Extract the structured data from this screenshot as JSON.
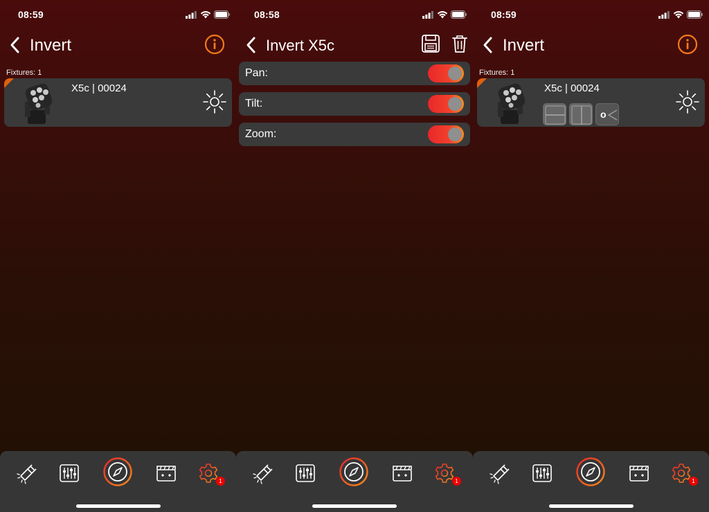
{
  "colors": {
    "accent": "#f27a1a",
    "toggle_on_start": "#e8272a",
    "toggle_on_end": "#f58c1d",
    "card": "#3a3a3a",
    "nav": "#363636",
    "badge": "#e00000"
  },
  "screens": [
    {
      "status_time": "08:59",
      "title": "Invert",
      "fixtures_label": "Fixtures: 1",
      "fixture_name": "X5c | 00024",
      "badge": "1"
    },
    {
      "status_time": "08:58",
      "title": "Invert X5c",
      "rows": [
        {
          "label": "Pan:",
          "on": true
        },
        {
          "label": "Tilt:",
          "on": true
        },
        {
          "label": "Zoom:",
          "on": true
        }
      ],
      "badge": "1"
    },
    {
      "status_time": "08:59",
      "title": "Invert",
      "fixtures_label": "Fixtures: 1",
      "fixture_name": "X5c | 00024",
      "flip_buttons": [
        "horizontal-split",
        "vertical-split",
        "zoom"
      ],
      "zoom_glyph": "o",
      "badge": "1"
    }
  ],
  "icons": {
    "back": "chevron-left-icon",
    "info": "info-icon",
    "save": "save-icon",
    "trash": "trash-icon",
    "bulb": "light-bulb-icon",
    "nav": [
      "flashlight-icon",
      "mixer-icon",
      "compass-icon",
      "clapperboard-icon",
      "gear-icon"
    ]
  }
}
